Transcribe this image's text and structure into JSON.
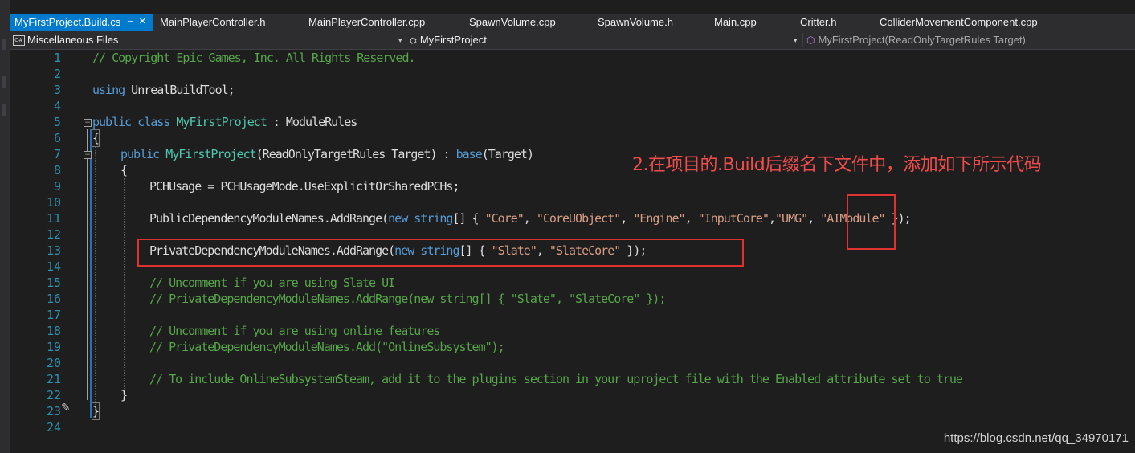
{
  "tabs": {
    "active": "MyFirstProject.Build.cs",
    "active_pin": "⊣",
    "active_close": "×",
    "others": [
      "MainPlayerController.h",
      "MainPlayerController.cpp",
      "SpawnVolume.cpp",
      "SpawnVolume.h",
      "Main.cpp",
      "Critter.h",
      "ColliderMovementComponent.cpp"
    ]
  },
  "navbar": {
    "project_scope": "Miscellaneous Files",
    "type_scope": "MyFirstProject",
    "member_scope": "MyFirstProject(ReadOnlyTargetRules Target)",
    "cs_icon_text": "C#",
    "member_icon": "⬡",
    "type_icon": "⛭"
  },
  "editor": {
    "line_numbers": [
      "1",
      "2",
      "3",
      "4",
      "5",
      "6",
      "7",
      "8",
      "9",
      "10",
      "11",
      "12",
      "13",
      "14",
      "15",
      "16",
      "17",
      "18",
      "19",
      "20",
      "21",
      "22",
      "23",
      "24"
    ],
    "lines": {
      "l1": "// Copyright Epic Games, Inc. All Rights Reserved.",
      "l3_kw": "using",
      "l3_rest": " UnrealBuildTool;",
      "l5_kw": "public class",
      "l5_type": "MyFirstProject",
      "l5_rest": " : ModuleRules",
      "l6": "{",
      "l7_kw": "public",
      "l7_type": "MyFirstProject",
      "l7_a": "(ReadOnlyTargetRules Target) : ",
      "l7_base": "base",
      "l7_b": "(Target)",
      "l8": "{",
      "l9": "PCHUsage = PCHUsageMode.UseExplicitOrSharedPCHs;",
      "l11_a": "PublicDependencyModuleNames.AddRange(",
      "l11_new": "new",
      "l11_string": " string",
      "l11_b": "[] { ",
      "l11_s1": "\"Core\"",
      "l11_c1": ", ",
      "l11_s2": "\"CoreUObject\"",
      "l11_c2": ", ",
      "l11_s3": "\"Engine\"",
      "l11_c3": ", ",
      "l11_s4": "\"InputCore\"",
      "l11_c4": ",",
      "l11_s5": "\"UMG\"",
      "l11_c5": ", ",
      "l11_s6": "\"AIModule\"",
      "l11_end": " });",
      "l13_a": "PrivateDependencyModuleNames.AddRange(",
      "l13_new": "new",
      "l13_string": " string",
      "l13_b": "[] { ",
      "l13_s1": "\"Slate\"",
      "l13_c1": ", ",
      "l13_s2": "\"SlateCore\"",
      "l13_end": " });",
      "l15": "// Uncomment if you are using Slate UI",
      "l16": "// PrivateDependencyModuleNames.AddRange(new string[] { \"Slate\", \"SlateCore\" });",
      "l18": "// Uncomment if you are using online features",
      "l19": "// PrivateDependencyModuleNames.Add(\"OnlineSubsystem\");",
      "l21": "// To include OnlineSubsystemSteam, add it to the plugins section in your uproject file with the Enabled attribute set to true",
      "l22": "}",
      "l23": "}"
    },
    "fold_minus": "−",
    "pencil_icon": "✎"
  },
  "annotation": {
    "text": "2.在项目的.Build后缀名下文件中，添加如下所示代码",
    "color": "#f14c4c"
  },
  "watermark": "https://blog.csdn.net/qq_34970171",
  "colors": {
    "background": "#1e1e1e",
    "keyword": "#569cd6",
    "type": "#4ec9b0",
    "string": "#d69d85",
    "comment": "#57a64a",
    "line_number": "#2b91af",
    "tab_active": "#007acc",
    "highlight_box": "#e03131"
  }
}
